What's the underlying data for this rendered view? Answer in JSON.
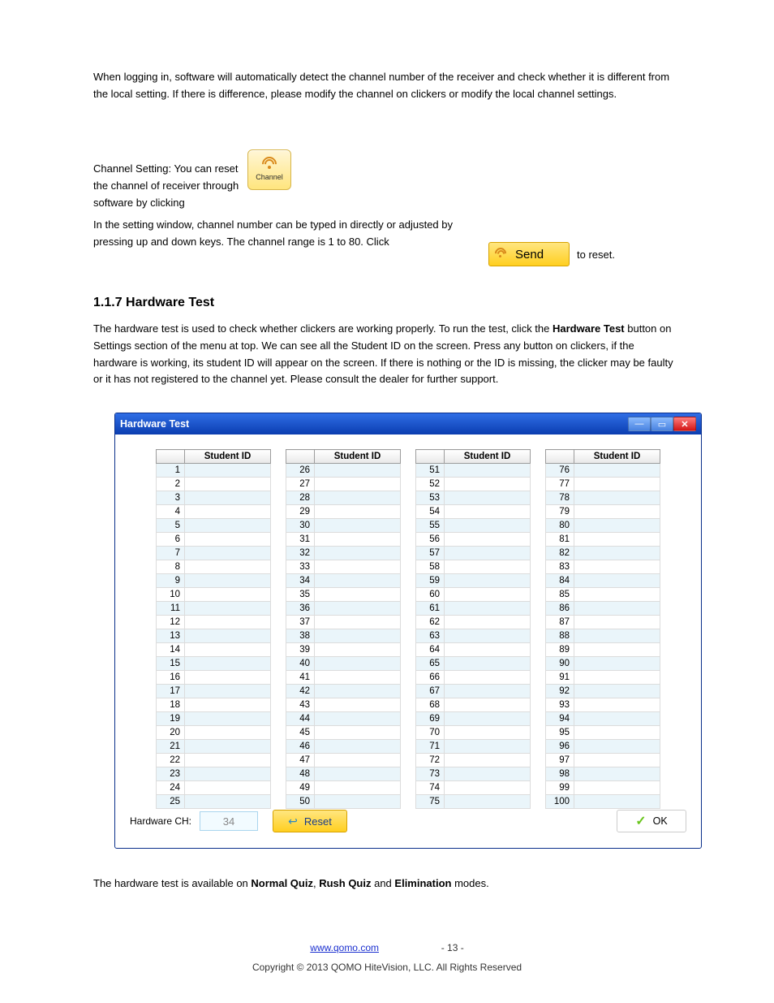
{
  "paras": {
    "p1": "When logging in, software will automatically detect the channel number of the receiver and check whether it is different from the local setting. If there is difference, please modify the channel on clickers or modify the local channel settings.",
    "p2": "Channel Setting: You can reset the channel of receiver through software by clicking",
    "p3a": "In the setting window, channel number can be typed in directly or adjusted by pressing up and down keys. The channel range is 1 to 80. Click",
    "p3b": "to reset.",
    "p4": "The hardware test is used to check whether clickers are working properly. To run the test, click the ",
    "p4b": "Hardware Test",
    "p4c": " button on Settings section of the menu at top. We can see all the Student ID on the screen. Press any button on clickers, if the hardware is working, its student ID will appear on the screen. If there is nothing or the ID is missing, the clicker may be faulty or it has not registered to the channel yet. Please consult the dealer for further support.",
    "p5a": "The hardware test is available on ",
    "p5b": "Normal Quiz",
    "p5c": "Rush Quiz",
    "p5d": " and ",
    "p5e": "Elimination",
    "p5f": " modes."
  },
  "headings": {
    "h1": "1.1.7 Hardware Test"
  },
  "channel_icon_label": "Channel",
  "send_label": "Send",
  "dialog": {
    "title": "Hardware Test",
    "header_student_id": "Student ID",
    "start_numbers": [
      1,
      26,
      51,
      76
    ],
    "hardware_ch_label": "Hardware CH:",
    "hardware_ch_value": "34",
    "reset_label": "Reset",
    "ok_label": "OK"
  },
  "footer": {
    "site": "www.qomo.com",
    "page": "- 13 -",
    "copyright": "Copyright © 2013 QOMO HiteVision, LLC. All Rights Reserved"
  }
}
